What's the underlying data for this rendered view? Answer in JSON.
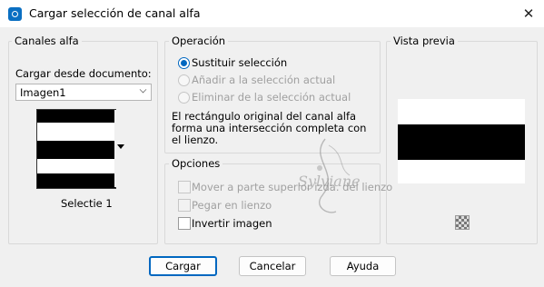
{
  "window": {
    "title": "Cargar selección de canal alfa",
    "close_glyph": "✕"
  },
  "alpha_channels": {
    "legend": "Canales alfa",
    "load_from_label": "Cargar desde documento:",
    "document_value": "Imagen1",
    "selected_channel": "Selectie 1"
  },
  "operation": {
    "legend": "Operación",
    "options": [
      {
        "label": "Sustituir selección",
        "selected": true,
        "enabled": true
      },
      {
        "label": "Añadir a la selección actual",
        "selected": false,
        "enabled": false
      },
      {
        "label": "Eliminar de la selección actual",
        "selected": false,
        "enabled": false
      }
    ],
    "description": [
      "El rectángulo original del canal alfa",
      "forma una intersección completa con",
      "el lienzo."
    ]
  },
  "options": {
    "legend": "Opciones",
    "items": [
      {
        "label": "Mover a parte superior izda. del lienzo",
        "checked": false,
        "enabled": false
      },
      {
        "label": "Pegar en lienzo",
        "checked": false,
        "enabled": false
      },
      {
        "label": "Invertir imagen",
        "checked": false,
        "enabled": true
      }
    ]
  },
  "preview": {
    "legend": "Vista previa"
  },
  "buttons": {
    "load": "Cargar",
    "cancel": "Cancelar",
    "help": "Ayuda"
  },
  "watermark": {
    "text": "Sylviane"
  },
  "colors": {
    "accent": "#0067c0",
    "titlebar": "#ffffff",
    "dialog_bg": "#f0f0f0"
  }
}
